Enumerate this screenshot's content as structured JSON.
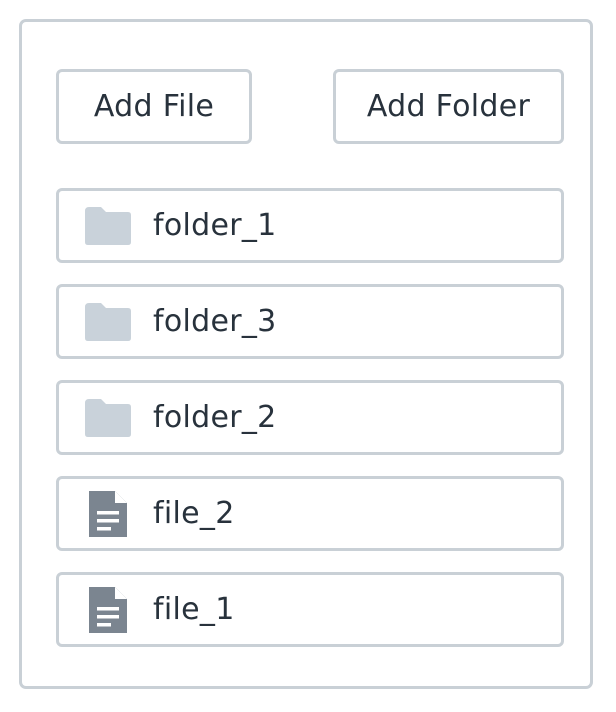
{
  "toolbar": {
    "add_file_label": "Add File",
    "add_folder_label": "Add Folder"
  },
  "items": [
    {
      "name": "folder_1",
      "type": "folder",
      "icon": "folder-icon"
    },
    {
      "name": "folder_3",
      "type": "folder",
      "icon": "folder-icon"
    },
    {
      "name": "folder_2",
      "type": "folder",
      "icon": "folder-icon"
    },
    {
      "name": "file_2",
      "type": "file",
      "icon": "file-icon"
    },
    {
      "name": "file_1",
      "type": "file",
      "icon": "file-icon"
    }
  ],
  "colors": {
    "border": "#c9d0d6",
    "text": "#28323c",
    "folder_icon": "#c9d2da",
    "file_icon": "#7b8590"
  }
}
